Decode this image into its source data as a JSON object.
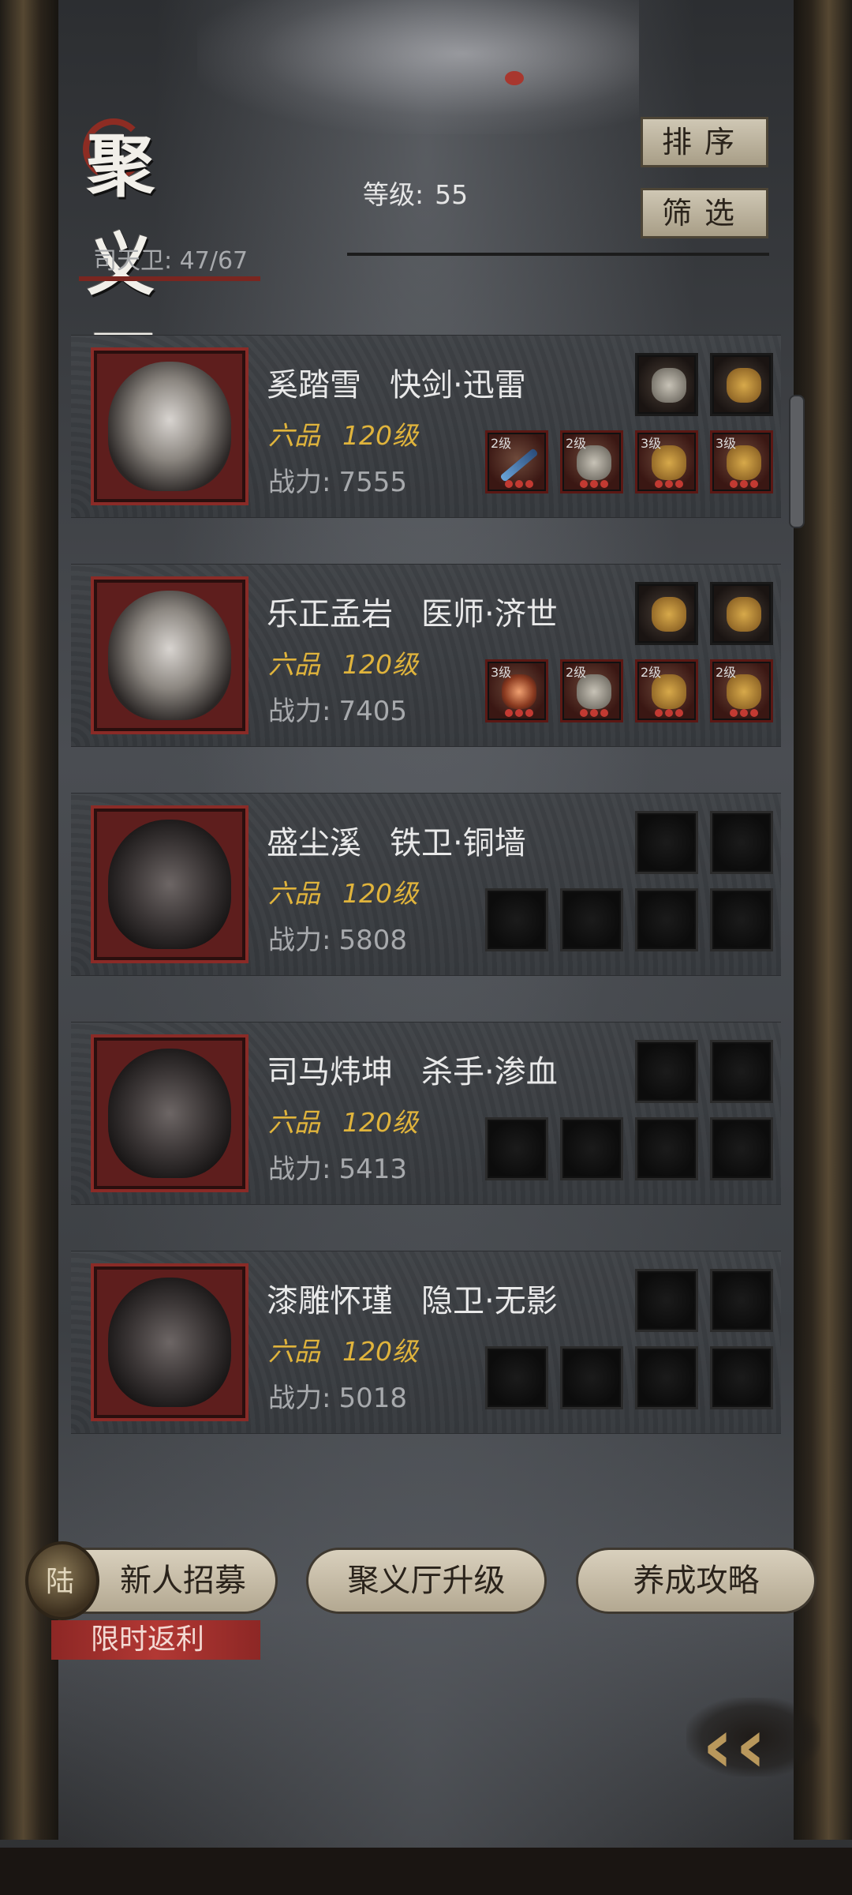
{
  "header": {
    "title": "聚义厅",
    "level_label": "等级:",
    "level_value": "55",
    "guard_label": "司天卫:",
    "guard_count": "47/67",
    "sort_button": "排序",
    "filter_button": "筛选"
  },
  "heroes": [
    {
      "name": "奚踏雪",
      "role": "快剑·迅雷",
      "rank": "六品",
      "level": "120级",
      "power_label": "战力:",
      "power": "7555",
      "equip_top": [
        {
          "lv": "",
          "type": "helmet"
        },
        {
          "lv": "",
          "type": "flail"
        }
      ],
      "equip_bottom": [
        {
          "lv": "2级",
          "type": "blade"
        },
        {
          "lv": "2级",
          "type": "armor"
        },
        {
          "lv": "3级",
          "type": "horse"
        },
        {
          "lv": "3级",
          "type": "horse"
        }
      ]
    },
    {
      "name": "乐正孟岩",
      "role": "医师·济世",
      "rank": "六品",
      "level": "120级",
      "power_label": "战力:",
      "power": "7405",
      "equip_top": [
        {
          "lv": "",
          "type": "flail"
        },
        {
          "lv": "",
          "type": "flail"
        }
      ],
      "equip_bottom": [
        {
          "lv": "3级",
          "type": "orb"
        },
        {
          "lv": "2级",
          "type": "armor"
        },
        {
          "lv": "2级",
          "type": "flail"
        },
        {
          "lv": "2级",
          "type": "flail"
        }
      ]
    },
    {
      "name": "盛尘溪",
      "role": "铁卫·铜墙",
      "rank": "六品",
      "level": "120级",
      "power_label": "战力:",
      "power": "5808",
      "equip_top": [
        {
          "lv": "",
          "type": "empty"
        },
        {
          "lv": "",
          "type": "empty"
        }
      ],
      "equip_bottom": [
        {
          "lv": "",
          "type": "empty"
        },
        {
          "lv": "",
          "type": "empty"
        },
        {
          "lv": "",
          "type": "empty"
        },
        {
          "lv": "",
          "type": "empty"
        }
      ]
    },
    {
      "name": "司马炜坤",
      "role": "杀手·渗血",
      "rank": "六品",
      "level": "120级",
      "power_label": "战力:",
      "power": "5413",
      "equip_top": [
        {
          "lv": "",
          "type": "empty"
        },
        {
          "lv": "",
          "type": "empty"
        }
      ],
      "equip_bottom": [
        {
          "lv": "",
          "type": "empty"
        },
        {
          "lv": "",
          "type": "empty"
        },
        {
          "lv": "",
          "type": "empty"
        },
        {
          "lv": "",
          "type": "empty"
        }
      ]
    },
    {
      "name": "漆雕怀瑾",
      "role": "隐卫·无影",
      "rank": "六品",
      "level": "120级",
      "power_label": "战力:",
      "power": "5018",
      "equip_top": [
        {
          "lv": "",
          "type": "empty"
        },
        {
          "lv": "",
          "type": "empty"
        }
      ],
      "equip_bottom": [
        {
          "lv": "",
          "type": "empty"
        },
        {
          "lv": "",
          "type": "empty"
        },
        {
          "lv": "",
          "type": "empty"
        },
        {
          "lv": "",
          "type": "empty"
        }
      ]
    }
  ],
  "bottom": {
    "recruit_button": "新人招募",
    "recruit_icon": "recruit-token-icon",
    "upgrade_button": "聚义厅升级",
    "guide_button": "养成攻略",
    "promo_tag": "限时返利",
    "back_icon": "double-chevron-left-icon"
  },
  "colors": {
    "accent_gold": "#e0b43c",
    "portrait_red": "#8a2b27",
    "button_beige": "#cfc7b4",
    "promo_red": "#b23834"
  }
}
